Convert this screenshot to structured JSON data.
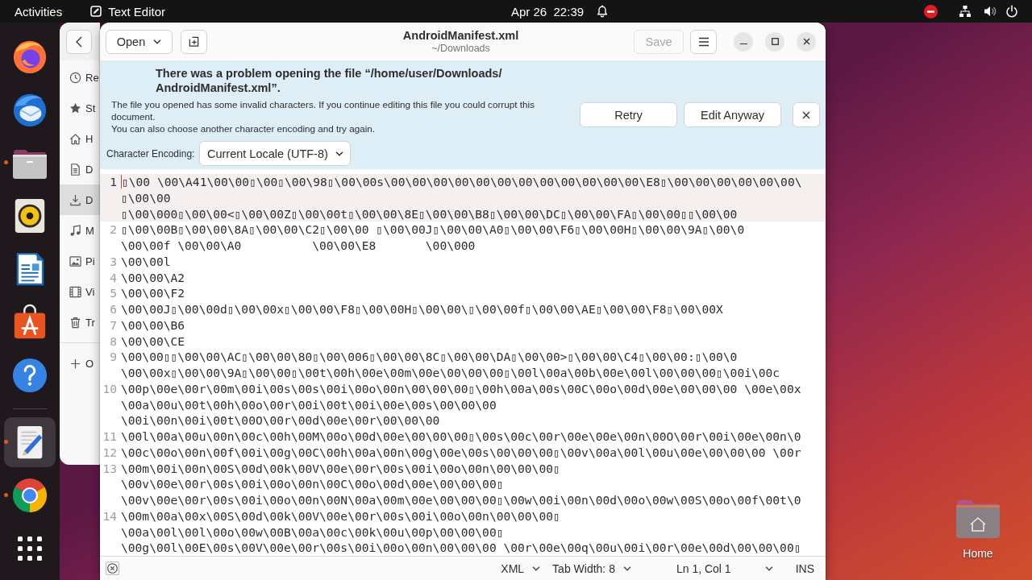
{
  "top_bar": {
    "activities": "Activities",
    "app_menu": "Text Editor",
    "clock": "Apr 26  22:39"
  },
  "dock": {
    "items": [
      {
        "running": false,
        "selected": false
      },
      {
        "running": false,
        "selected": false
      },
      {
        "running": true,
        "selected": false
      },
      {
        "running": false,
        "selected": false
      },
      {
        "running": false,
        "selected": false
      },
      {
        "running": false,
        "selected": false
      },
      {
        "running": false,
        "selected": false
      },
      {
        "running": true,
        "selected": true
      },
      {
        "running": true,
        "selected": false
      },
      {
        "running": false,
        "selected": false
      }
    ]
  },
  "files_window": {
    "sidebar": [
      {
        "label": "Re",
        "selected": false
      },
      {
        "label": "St",
        "selected": false
      },
      {
        "label": "H",
        "selected": false
      },
      {
        "label": "D",
        "selected": false
      },
      {
        "label": "D",
        "selected": true
      },
      {
        "label": "M",
        "selected": false
      },
      {
        "label": "Pi",
        "selected": false
      },
      {
        "label": "Vi",
        "selected": false
      },
      {
        "label": "Tr",
        "selected": false
      },
      {
        "label": "O",
        "selected": false
      }
    ]
  },
  "editor": {
    "header": {
      "open_button": "Open",
      "title": "AndroidManifest.xml",
      "subtitle": "~/Downloads",
      "save_button": {
        "label": "Save",
        "disabled": true
      }
    },
    "infobar": {
      "title": "There was a problem opening the file “/home/user/Downloads/AndroidManifest.xml”.",
      "messages": [
        "The file you opened has some invalid characters. If you continue editing this file you could corrupt this document.",
        "You can also choose another character encoding and try again."
      ],
      "encoding_label": "Character Encoding:",
      "encoding_value": "Current Locale (UTF-8)",
      "buttons": [
        "Retry",
        "Edit Anyway"
      ]
    },
    "lines": [
      {
        "number": "1",
        "current": true,
        "rows": [
          "▯\\00 \\00\\A41\\00\\00▯\\00▯\\00\\98▯\\00\\00s\\00\\00\\00\\00\\00\\00\\00\\00\\00\\00\\00\\00\\E8▯\\00\\00\\00\\00\\00\\00\\",
          "▯\\00\\00",
          "▯\\00\\000▯\\00\\00<▯\\00\\00Z▯\\00\\00t▯\\00\\00\\8E▯\\00\\00\\B8▯\\00\\00\\DC▯\\00\\00\\FA▯\\00\\00▯▯\\00\\00"
        ]
      },
      {
        "number": "2",
        "current": false,
        "rows": [
          "▯\\00\\00B▯\\00\\00\\8A▯\\00\\00\\C2▯\\00\\00 ▯\\00\\00J▯\\00\\00\\A0▯\\00\\00\\F6▯\\00\\00H▯\\00\\00\\9A▯\\00\\0",
          "\\00\\00f \\00\\00\\A0          \\00\\00\\E8       \\00\\000"
        ]
      },
      {
        "number": "3",
        "current": false,
        "rows": [
          "\\00\\00l"
        ]
      },
      {
        "number": "4",
        "current": false,
        "rows": [
          "\\00\\00\\A2"
        ]
      },
      {
        "number": "5",
        "current": false,
        "rows": [
          "\\00\\00\\F2"
        ]
      },
      {
        "number": "6",
        "current": false,
        "rows": [
          "\\00\\00J▯\\00\\00d▯\\00\\00x▯\\00\\00\\F8▯\\00\\00H▯\\00\\00\\▯\\00\\00f▯\\00\\00\\AE▯\\00\\00\\F8▯\\00\\00X"
        ]
      },
      {
        "number": "7",
        "current": false,
        "rows": [
          "\\00\\00\\B6"
        ]
      },
      {
        "number": "8",
        "current": false,
        "rows": [
          "\\00\\00\\CE"
        ]
      },
      {
        "number": "9",
        "current": false,
        "rows": [
          "\\00\\00▯▯\\00\\00\\AC▯\\00\\00\\80▯\\00\\006▯\\00\\00\\8C▯\\00\\00\\DA▯\\00\\00>▯\\00\\00\\C4▯\\00\\00:▯\\00\\0",
          "\\00\\00x▯\\00\\00\\9A▯\\00\\00▯\\00t\\00h\\00e\\00m\\00e\\00\\00\\00▯\\00l\\00a\\00b\\00e\\00l\\00\\00\\00▯\\00i\\00c"
        ]
      },
      {
        "number": "10",
        "current": false,
        "rows": [
          "\\00p\\00e\\00r\\00m\\00i\\00s\\00s\\00i\\00o\\00n\\00\\00\\00▯\\00h\\00a\\00s\\00C\\00o\\00d\\00e\\00\\00\\00 \\00e\\00x",
          "\\00a\\00u\\00t\\00h\\00o\\00r\\00i\\00t\\00i\\00e\\00s\\00\\00\\00",
          "\\00i\\00n\\00i\\00t\\00O\\00r\\00d\\00e\\00r\\00\\00\\00"
        ]
      },
      {
        "number": "11",
        "current": false,
        "rows": [
          "\\00l\\00a\\00u\\00n\\00c\\00h\\00M\\00o\\00d\\00e\\00\\00\\00▯\\00s\\00c\\00r\\00e\\00e\\00n\\00O\\00r\\00i\\00e\\00n\\0"
        ]
      },
      {
        "number": "12",
        "current": false,
        "rows": [
          "\\00c\\00o\\00n\\00f\\00i\\00g\\00C\\00h\\00a\\00n\\00g\\00e\\00s\\00\\00\\00▯\\00v\\00a\\00l\\00u\\00e\\00\\00\\00 \\00r"
        ]
      },
      {
        "number": "13",
        "current": false,
        "rows": [
          "\\00m\\00i\\00n\\00S\\00d\\00k\\00V\\00e\\00r\\00s\\00i\\00o\\00n\\00\\00\\00▯",
          "\\00v\\00e\\00r\\00s\\00i\\00o\\00n\\00C\\00o\\00d\\00e\\00\\00\\00▯",
          "\\00v\\00e\\00r\\00s\\00i\\00o\\00n\\00N\\00a\\00m\\00e\\00\\00\\00▯\\00w\\00i\\00n\\00d\\00o\\00w\\00S\\00o\\00f\\00t\\0"
        ]
      },
      {
        "number": "14",
        "current": false,
        "rows": [
          "\\00m\\00a\\00x\\00S\\00d\\00k\\00V\\00e\\00r\\00s\\00i\\00o\\00n\\00\\00\\00▯",
          "\\00a\\00l\\00l\\00o\\00w\\00B\\00a\\00c\\00k\\00u\\00p\\00\\00\\00▯",
          "\\00g\\00l\\00E\\00s\\00V\\00e\\00r\\00s\\00i\\00o\\00n\\00\\00\\00 \\00r\\00e\\00q\\00u\\00i\\00r\\00e\\00d\\00\\00\\00▯"
        ]
      }
    ],
    "status_bar": {
      "language": "XML",
      "tab_width": "Tab Width: 8",
      "position": "Ln 1, Col 1",
      "mode": "INS"
    }
  },
  "desktop_icons": [
    {
      "label": "Home"
    }
  ]
}
